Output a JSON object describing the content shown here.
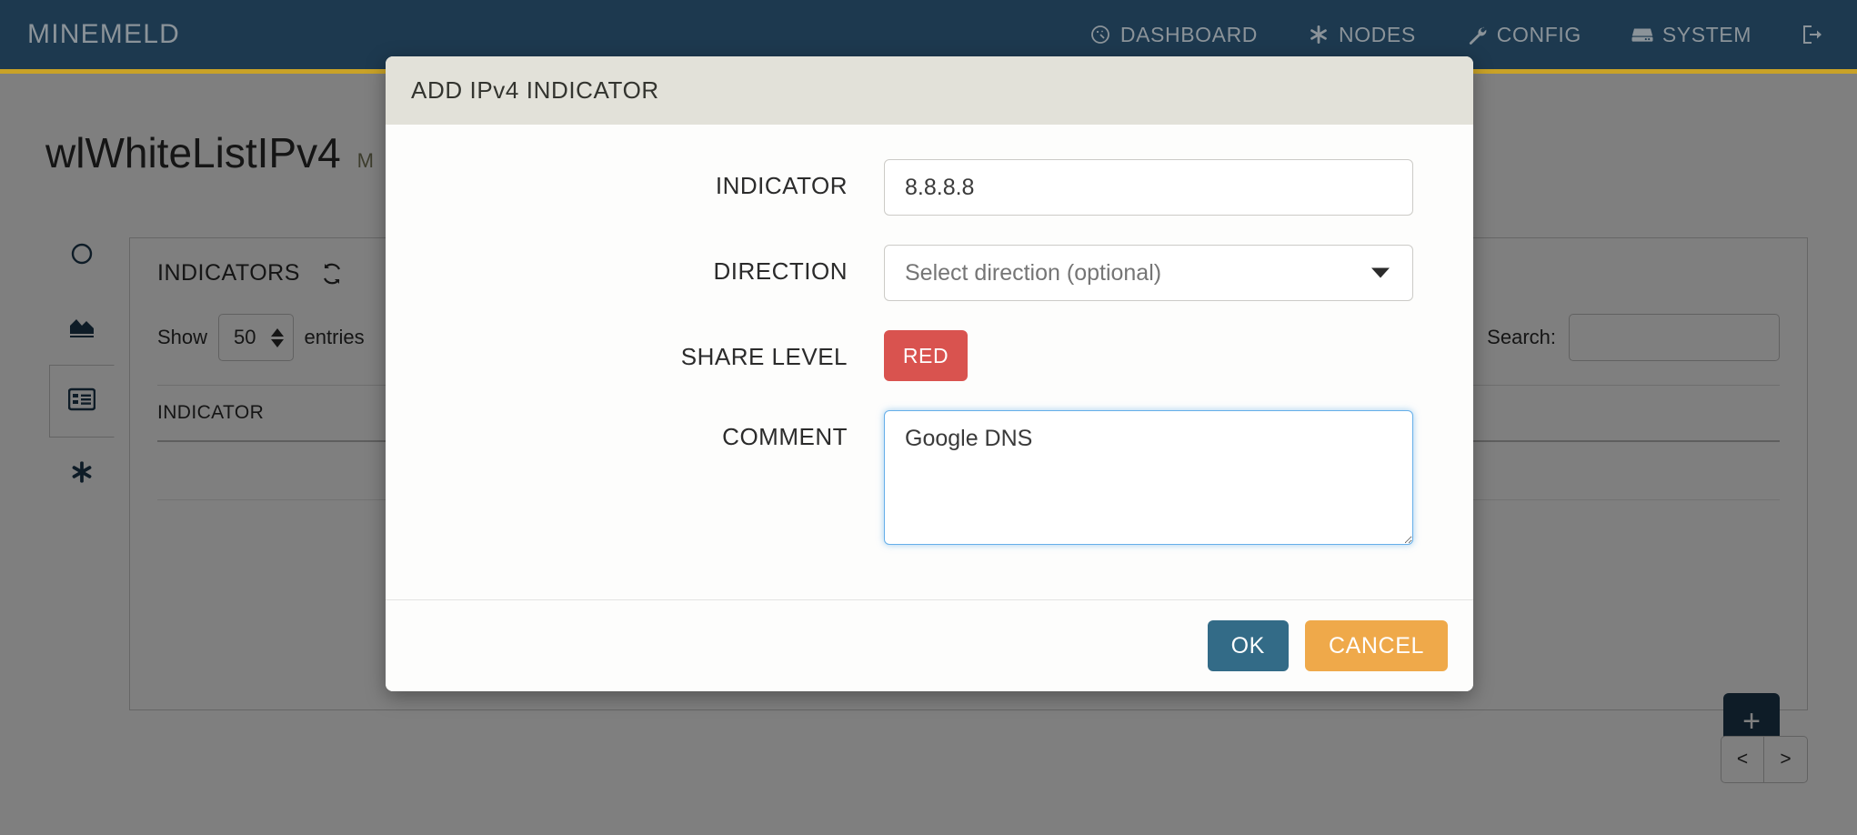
{
  "navbar": {
    "brand": "MINEMELD",
    "items": [
      {
        "label": "DASHBOARD",
        "icon": "dashboard-gauge-icon"
      },
      {
        "label": "NODES",
        "icon": "asterisk-icon"
      },
      {
        "label": "CONFIG",
        "icon": "wrench-icon"
      },
      {
        "label": "SYSTEM",
        "icon": "server-icon"
      }
    ],
    "logout_icon": "logout-icon",
    "accent_color": "#c9a227",
    "background_color": "#1d394f"
  },
  "page": {
    "title": "wlWhiteListIPv4",
    "subtitle": "M",
    "rail": [
      {
        "icon": "circle-icon",
        "name": "status"
      },
      {
        "icon": "chart-icon",
        "name": "graph"
      },
      {
        "icon": "table-icon",
        "name": "indicators"
      },
      {
        "icon": "asterisk-icon",
        "name": "settings"
      }
    ],
    "panel": {
      "title": "INDICATORS",
      "refresh_icon": "refresh-icon",
      "show_label": "Show",
      "entries_value": "50",
      "entries_label": "entries",
      "search_label": "Search:",
      "search_value": "",
      "columns": [
        "INDICATOR"
      ],
      "rows": []
    },
    "add_button_label": "+",
    "pager": {
      "prev": "<",
      "next": ">"
    }
  },
  "modal": {
    "title": "ADD IPv4 INDICATOR",
    "fields": {
      "indicator": {
        "label": "INDICATOR",
        "value": "8.8.8.8"
      },
      "direction": {
        "label": "DIRECTION",
        "placeholder": "Select direction (optional)",
        "value": ""
      },
      "share_level": {
        "label": "SHARE LEVEL",
        "value": "RED",
        "color": "#d9534f"
      },
      "comment": {
        "label": "COMMENT",
        "value": "Google DNS"
      }
    },
    "buttons": {
      "ok": "OK",
      "cancel": "CANCEL",
      "ok_color": "#336b87",
      "cancel_color": "#efa94a"
    }
  }
}
